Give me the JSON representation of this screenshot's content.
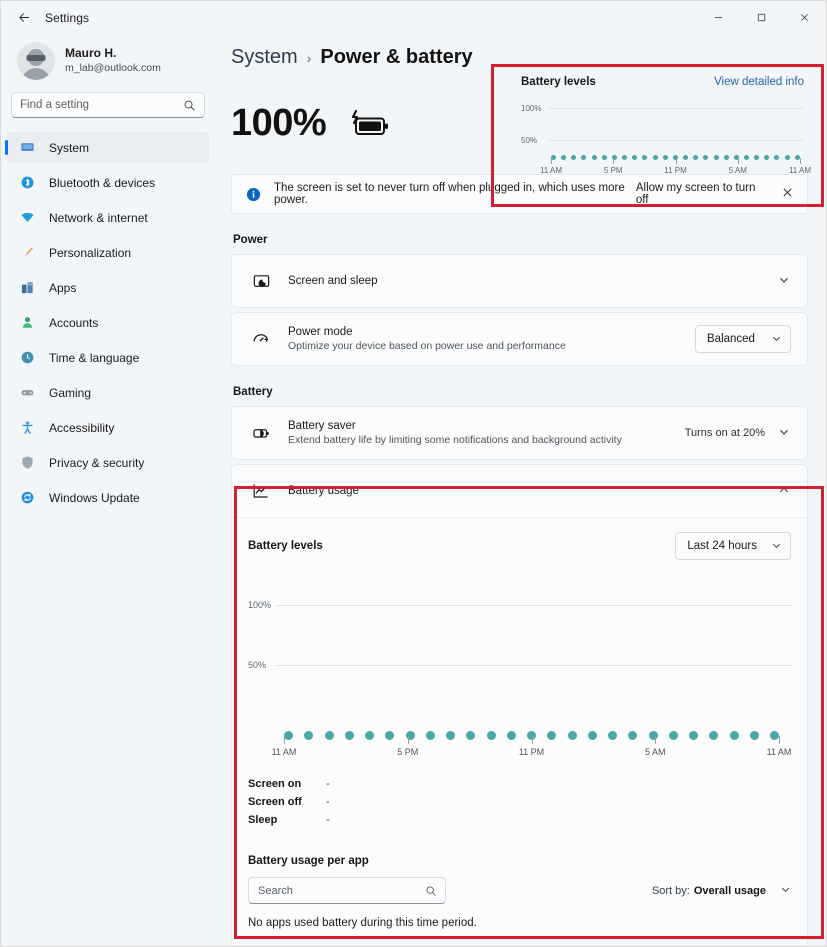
{
  "window": {
    "title": "Settings",
    "back_icon": "arrow-left-icon",
    "minimize_label": "–",
    "maximize_label": "☐",
    "close_label": "✕"
  },
  "account": {
    "name": "Mauro H.",
    "email": "m_lab@outlook.com"
  },
  "search": {
    "placeholder": "Find a setting",
    "value": ""
  },
  "sidebar": {
    "items": [
      {
        "label": "System",
        "icon": "monitor-icon",
        "active": true
      },
      {
        "label": "Bluetooth & devices",
        "icon": "bluetooth-icon",
        "active": false
      },
      {
        "label": "Network & internet",
        "icon": "wifi-icon",
        "active": false
      },
      {
        "label": "Personalization",
        "icon": "paintbrush-icon",
        "active": false
      },
      {
        "label": "Apps",
        "icon": "apps-grid-icon",
        "active": false
      },
      {
        "label": "Accounts",
        "icon": "person-icon",
        "active": false
      },
      {
        "label": "Time & language",
        "icon": "clock-icon",
        "active": false
      },
      {
        "label": "Gaming",
        "icon": "gamepad-icon",
        "active": false
      },
      {
        "label": "Accessibility",
        "icon": "accessibility-icon",
        "active": false
      },
      {
        "label": "Privacy & security",
        "icon": "shield-icon",
        "active": false
      },
      {
        "label": "Windows Update",
        "icon": "update-refresh-icon",
        "active": false
      }
    ]
  },
  "breadcrumb": {
    "root": "System",
    "separator": "›",
    "current": "Power & battery"
  },
  "hero": {
    "percent": "100%",
    "battery_icon": "battery-charging-icon"
  },
  "banner": {
    "icon": "info-icon",
    "text": "The screen is set to never turn off when plugged in, which uses more power.",
    "action": "Allow my screen to turn off",
    "close_icon": "close-icon"
  },
  "power_section": {
    "title": "Power",
    "rows": [
      {
        "title": "Screen and sleep",
        "subtitle": "",
        "icon": "screen-sleep-icon",
        "value": "",
        "chevron": "⌄"
      },
      {
        "title": "Power mode",
        "subtitle": "Optimize your device based on power use and performance",
        "icon": "power-gauge-icon",
        "value": "Balanced",
        "chevron": "⌄"
      }
    ]
  },
  "battery_section": {
    "title": "Battery",
    "saver": {
      "title": "Battery saver",
      "subtitle": "Extend battery life by limiting some notifications and background activity",
      "icon": "battery-saver-icon",
      "value": "Turns on at 20%",
      "chevron": "⌄"
    },
    "usage": {
      "title": "Battery usage",
      "icon": "line-chart-icon",
      "expanded": true,
      "chevron": "⌃"
    }
  },
  "usage_panel": {
    "levels_title": "Battery levels",
    "range_value": "Last 24 hours",
    "range_chevron": "⌄",
    "legend": [
      {
        "label": "Screen on",
        "value": "-"
      },
      {
        "label": "Screen off",
        "value": "-"
      },
      {
        "label": "Sleep",
        "value": "-"
      }
    ],
    "per_app": {
      "title": "Battery usage per app",
      "search_placeholder": "Search",
      "search_value": "",
      "sort_label": "Sort by:",
      "sort_value": "Overall usage",
      "sort_chevron": "⌄",
      "empty_message": "No apps used battery during this time period."
    }
  },
  "mini_card": {
    "title": "Battery levels",
    "link": "View detailed info"
  },
  "colors": {
    "accent": "#0d6efd",
    "chart_dot": "#4ba6a6",
    "annotation": "#d32030",
    "link": "#2563a8"
  },
  "chart_data": [
    {
      "id": "mini-battery-levels",
      "type": "scatter",
      "title": "Battery levels",
      "xlabel": "",
      "ylabel": "",
      "ylim": [
        0,
        100
      ],
      "ytick_labels": [
        "100%",
        "50%"
      ],
      "ytick_values": [
        100,
        50
      ],
      "xtick_labels": [
        "11 AM",
        "5 PM",
        "11 PM",
        "5 AM",
        "11 AM"
      ],
      "grid": true,
      "legend": "none",
      "x": [
        "11 AM",
        "12 PM",
        "1 PM",
        "2 PM",
        "3 PM",
        "4 PM",
        "5 PM",
        "6 PM",
        "7 PM",
        "8 PM",
        "9 PM",
        "10 PM",
        "11 PM",
        "12 AM",
        "1 AM",
        "2 AM",
        "3 AM",
        "4 AM",
        "5 AM",
        "6 AM",
        "7 AM",
        "8 AM",
        "9 AM",
        "10 AM",
        "11 AM"
      ],
      "values": [
        0,
        0,
        0,
        0,
        0,
        0,
        0,
        0,
        0,
        0,
        0,
        0,
        0,
        0,
        0,
        0,
        0,
        0,
        0,
        0,
        0,
        0,
        0,
        0,
        0
      ],
      "point_count": 25
    },
    {
      "id": "battery-usage-levels",
      "type": "scatter",
      "title": "Battery levels",
      "xlabel": "",
      "ylabel": "",
      "ylim": [
        0,
        100
      ],
      "ytick_labels": [
        "100%",
        "50%"
      ],
      "ytick_values": [
        100,
        50
      ],
      "xtick_labels": [
        "11 AM",
        "5 PM",
        "11 PM",
        "5 AM",
        "11 AM"
      ],
      "grid": true,
      "legend": "none",
      "x": [
        "11 AM",
        "12 PM",
        "1 PM",
        "2 PM",
        "3 PM",
        "4 PM",
        "5 PM",
        "6 PM",
        "7 PM",
        "8 PM",
        "9 PM",
        "10 PM",
        "11 PM",
        "12 AM",
        "1 AM",
        "2 AM",
        "3 AM",
        "4 AM",
        "5 AM",
        "6 AM",
        "7 AM",
        "8 AM",
        "9 AM",
        "10 AM",
        "11 AM"
      ],
      "values": [
        0,
        0,
        0,
        0,
        0,
        0,
        0,
        0,
        0,
        0,
        0,
        0,
        0,
        0,
        0,
        0,
        0,
        0,
        0,
        0,
        0,
        0,
        0,
        0,
        0
      ],
      "point_count": 25
    }
  ]
}
